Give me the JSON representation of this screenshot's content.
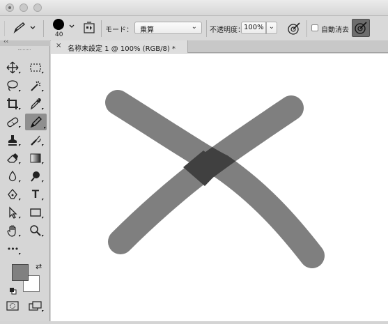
{
  "window": {
    "traffic_lights": [
      "close-button",
      "minimize-button",
      "zoom-button"
    ]
  },
  "options_bar": {
    "tool_preset_icon": "pencil-icon",
    "brush_size": "40",
    "mode_label": "モード：",
    "mode_value": "乗算",
    "opacity_label": "不透明度：",
    "opacity_value": "100%",
    "auto_erase_label": "自動消去",
    "auto_erase_checked": false
  },
  "document_tab": {
    "title": "名称未設定 1 @ 100% (RGB/8) *",
    "close_glyph": "×"
  },
  "toolbar": {
    "collapse_glyph": "‹‹",
    "tools": [
      {
        "name": "move-tool",
        "icon": "move-icon"
      },
      {
        "name": "marquee-tool",
        "icon": "rect-marquee-icon"
      },
      {
        "name": "lasso-tool",
        "icon": "lasso-icon"
      },
      {
        "name": "magic-wand-tool",
        "icon": "magic-wand-icon"
      },
      {
        "name": "crop-tool",
        "icon": "crop-icon"
      },
      {
        "name": "eyedropper-tool",
        "icon": "eyedropper-icon"
      },
      {
        "name": "healing-brush-tool",
        "icon": "bandage-icon"
      },
      {
        "name": "pencil-tool",
        "icon": "pencil-icon",
        "selected": true
      },
      {
        "name": "clone-stamp-tool",
        "icon": "stamp-icon"
      },
      {
        "name": "history-brush-tool",
        "icon": "history-brush-icon"
      },
      {
        "name": "eraser-tool",
        "icon": "eraser-icon"
      },
      {
        "name": "gradient-tool",
        "icon": "gradient-icon"
      },
      {
        "name": "blur-tool",
        "icon": "drop-icon"
      },
      {
        "name": "dodge-tool",
        "icon": "dodge-icon"
      },
      {
        "name": "pen-tool",
        "icon": "pen-icon"
      },
      {
        "name": "type-tool",
        "icon": "type-icon",
        "label": "T"
      },
      {
        "name": "path-selection-tool",
        "icon": "arrow-icon"
      },
      {
        "name": "rectangle-tool",
        "icon": "rectangle-icon"
      },
      {
        "name": "hand-tool",
        "icon": "hand-icon"
      },
      {
        "name": "zoom-tool",
        "icon": "zoom-icon"
      },
      {
        "name": "more-tools",
        "icon": "ellipsis-icon",
        "label": "•••"
      }
    ],
    "foreground_color": "#808080",
    "background_color": "#ffffff"
  },
  "colors": {
    "panel": "#d6d6d6",
    "canvas": "#ffffff",
    "stroke": "#7f7f7f",
    "overlap": "#404040"
  }
}
